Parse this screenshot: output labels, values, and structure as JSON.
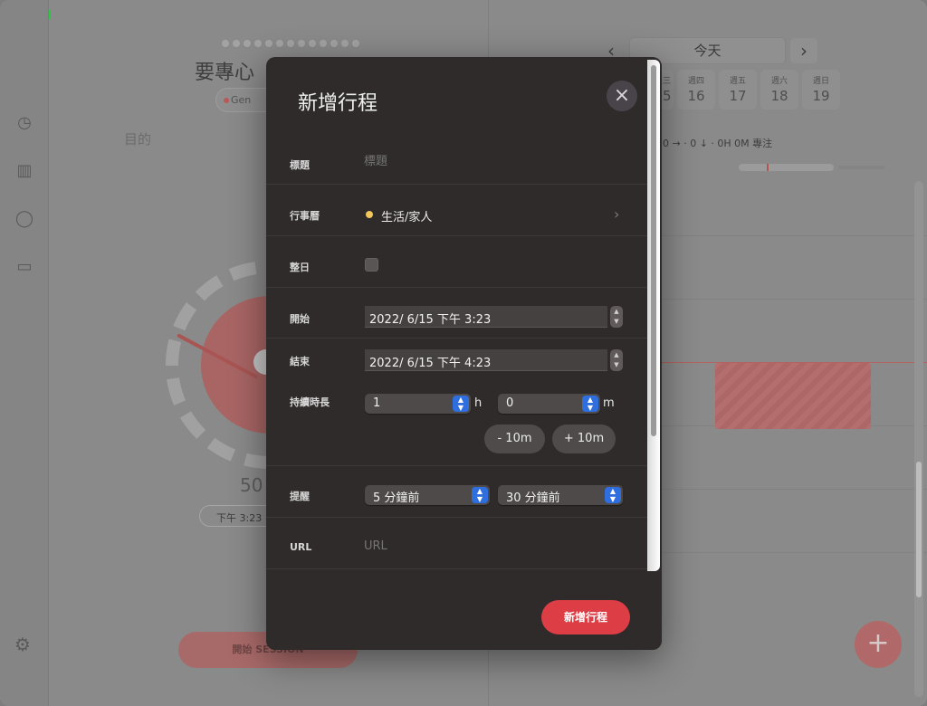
{
  "background": {
    "left": {
      "title": "要專心",
      "tag": "Gen",
      "goal_placeholder": "目的",
      "big_number": "50",
      "time_range": "下午 3:23 ·",
      "start_button": "開始 SESSION"
    },
    "right": {
      "today_label": "今天",
      "days": [
        {
          "name": "週三",
          "date": "15"
        },
        {
          "name": "週四",
          "date": "16"
        },
        {
          "name": "週五",
          "date": "17"
        },
        {
          "name": "週六",
          "date": "18"
        },
        {
          "name": "週日",
          "date": "19"
        }
      ],
      "stats": "0 → · 0 ↓ · 0H 0M 專注",
      "bottom_text": "......"
    }
  },
  "modal": {
    "title": "新增行程",
    "close_icon": "×",
    "fields": {
      "title_label": "標題",
      "title_placeholder": "標題",
      "calendar_label": "行事曆",
      "calendar_value": "生活/家人",
      "calendar_color": "#f1c65a",
      "allday_label": "整日",
      "start_label": "開始",
      "start_value": "2022/  6/15 下午  3:23",
      "end_label": "結束",
      "end_value": "2022/  6/15 下午  4:23",
      "duration_label": "持續時長",
      "duration_hours": "1",
      "duration_hours_unit": "h",
      "duration_minutes": "0",
      "duration_minutes_unit": "m",
      "minus_button": "- 10m",
      "plus_button": "+ 10m",
      "reminder_label": "提醒",
      "reminder_first": "5 分鐘前",
      "reminder_second": "30 分鐘前",
      "url_label": "URL",
      "url_placeholder": "URL"
    },
    "submit_button": "新增行程"
  },
  "colors": {
    "accent": "#dd3d44",
    "select_arrow": "#2f6ede"
  }
}
